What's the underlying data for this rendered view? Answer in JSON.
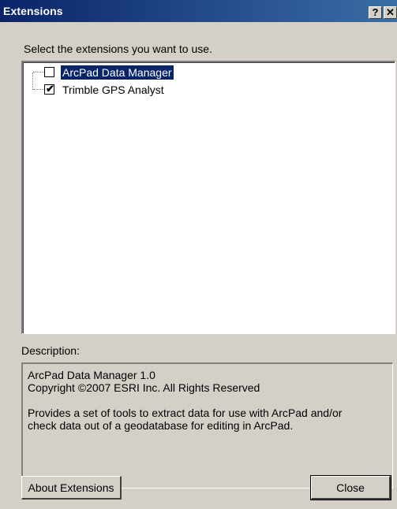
{
  "window": {
    "title": "Extensions",
    "help_glyph": "?",
    "close_glyph": "✕"
  },
  "instructions": "Select the extensions you want to use.",
  "extensions": [
    {
      "label": "ArcPad Data Manager",
      "checked": false,
      "selected": true,
      "check_glyph": ""
    },
    {
      "label": "Trimble GPS Analyst",
      "checked": true,
      "selected": false,
      "check_glyph": "✔"
    }
  ],
  "description": {
    "label": "Description:",
    "lines": [
      "ArcPad Data Manager 1.0",
      "Copyright ©2007 ESRI Inc. All Rights Reserved",
      "",
      "Provides a set of tools to extract data for use with ArcPad and/or",
      "check data out of a geodatabase for editing in ArcPad."
    ]
  },
  "buttons": {
    "about_label": "About Extensions",
    "close_label": "Close"
  },
  "colors": {
    "titlebar": "#0a246a",
    "face": "#d4d0c8",
    "selection": "#0a246a"
  }
}
